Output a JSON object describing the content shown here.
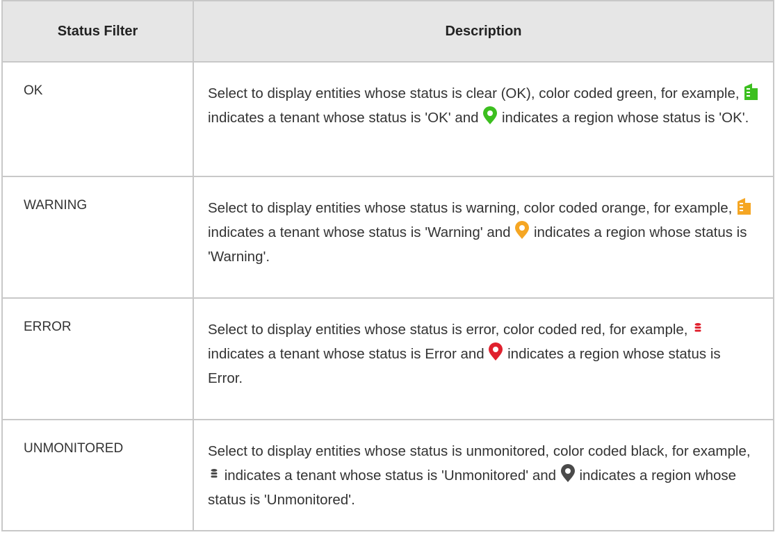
{
  "header": {
    "col1": "Status Filter",
    "col2": "Description"
  },
  "rows": [
    {
      "filter": "OK",
      "desc_a": "Select to display entities whose status is clear (OK), color coded green, for example,",
      "desc_b": "indicates a tenant whose status is 'OK' and",
      "desc_c": "indicates a region whose status is 'OK'.",
      "tenant_icon": "tenant-building-icon",
      "region_icon": "region-pin-icon",
      "color": "#3cbf1f"
    },
    {
      "filter": "WARNING",
      "desc_a": "Select to display entities whose status is warning, color coded orange, for example,",
      "desc_b": "indicates a tenant whose status is 'Warning' and",
      "desc_c": "indicates a region whose status is 'Warning'.",
      "tenant_icon": "tenant-building-icon",
      "region_icon": "region-pin-icon",
      "color": "#f5a623"
    },
    {
      "filter": "ERROR",
      "desc_a": "Select to display entities whose status is error, color coded red, for example,",
      "desc_b": "indicates a tenant whose status is Error and",
      "desc_c": "indicates a region whose status is Error.",
      "tenant_icon": "tenant-database-icon",
      "region_icon": "region-pin-icon",
      "color": "#e0212e"
    },
    {
      "filter": "UNMONITORED",
      "desc_a": "Select to display entities whose status is unmonitored, color coded black, for example,",
      "desc_b": "indicates a tenant whose status is 'Unmonitored' and",
      "desc_c": "indicates a region whose status is 'Unmonitored'.",
      "tenant_icon": "tenant-database-icon",
      "region_icon": "region-pin-icon",
      "color": "#4a4a4a"
    }
  ]
}
